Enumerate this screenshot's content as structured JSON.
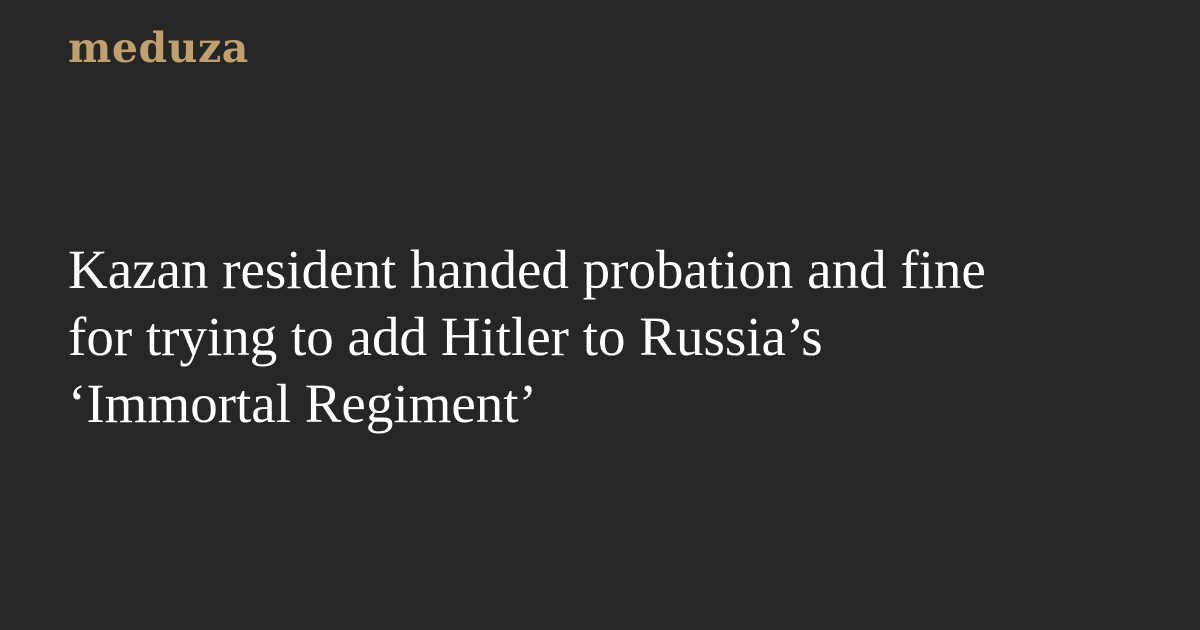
{
  "brand": {
    "logo_text": "meduza",
    "color": "#c0a06f"
  },
  "article": {
    "headline": "Kazan resident handed probation and fine\nfor trying to add Hitler to Russia’s\n‘Immortal Regiment’"
  },
  "colors": {
    "background": "#262626",
    "headline": "#ffffff"
  }
}
